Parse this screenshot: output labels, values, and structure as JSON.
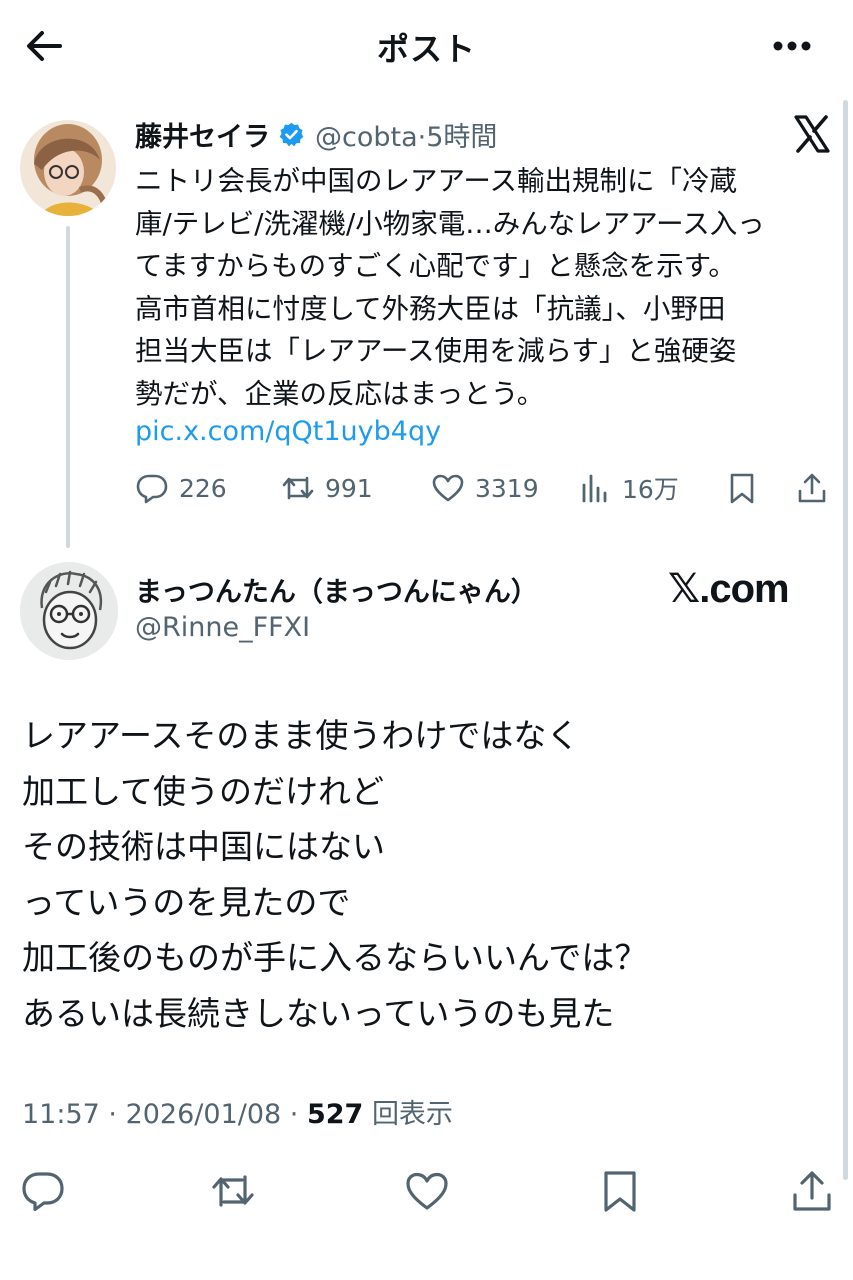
{
  "header": {
    "title": "ポスト"
  },
  "parent_post": {
    "author_name": "藤井セイラ",
    "handle": "@cobta",
    "separator": "·",
    "time": "5時間",
    "text": "ニトリ会長が中国のレアアース輸出規制に「冷蔵\n庫/テレビ/洗濯機/小物家電…みんなレアアース入っ\nてますからものすごく心配です」と懸念を示す。\n高市首相に忖度して外務大臣は「抗議」、小野田\n担当大臣は「レアアース使用を減らす」と強硬姿\n勢だが、企業の反応はまっとう。",
    "link": "pic.x.com/qQt1uyb4qy",
    "stats": {
      "replies": "226",
      "reposts": "991",
      "likes": "3319",
      "views": "16万"
    },
    "icons": [
      "reply-icon",
      "repost-icon",
      "like-icon",
      "views-icon",
      "bookmark-icon",
      "share-icon"
    ]
  },
  "main_post": {
    "author_name": "まっつんたん（まっつんにゃん）",
    "handle": "@Rinne_FFXI",
    "badge": "𝕏.com",
    "text": "レアアースそのまま使うわけではなく\n加工して使うのだけれど\nその技術は中国にはない\nっていうのを見たので\n加工後のものが手に入るならいいんでは？\nあるいは長続きしないっていうのも見た",
    "time": "11:57",
    "date": "2026/01/08",
    "views_count": "527",
    "views_label": "回表示"
  },
  "colors": {
    "accent": "#1d9bf0",
    "text": "#0f1419",
    "muted": "#536471",
    "divider": "#cfd9de"
  }
}
